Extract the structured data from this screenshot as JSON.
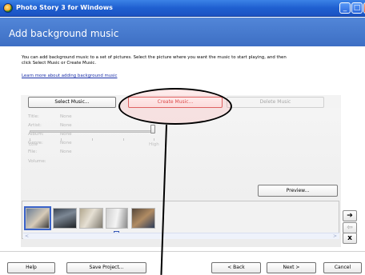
{
  "window": {
    "title": "Photo Story 3 for Windows",
    "icon": "photo-story-icon",
    "controls": {
      "minimize": "_",
      "maximize": "□",
      "close": "x"
    }
  },
  "header": {
    "title": "Add background music"
  },
  "instructions": {
    "line1": "You can add background music to a set of pictures.  Select the picture where you want the music to start playing, and then",
    "line2": "click Select Music or Create Music.",
    "learn_more": "Learn more about adding background music"
  },
  "music_buttons": {
    "select": "Select Music...",
    "create": "Create Music...",
    "delete": "Delete Music"
  },
  "metadata": [
    {
      "key": "Title:",
      "value": "None"
    },
    {
      "key": "Artist:",
      "value": "None"
    },
    {
      "key": "Album:",
      "value": "None"
    },
    {
      "key": "Genre:",
      "value": "None"
    },
    {
      "key": "File:",
      "value": "None"
    }
  ],
  "volume": {
    "label": "Volume:",
    "low": "Low",
    "high": "High",
    "level": 1.0
  },
  "preview_button": "Preview...",
  "filmstrip": {
    "thumbnails": [
      "photo-1",
      "photo-2",
      "photo-3",
      "photo-4",
      "photo-5"
    ]
  },
  "side_buttons": {
    "right": "➔",
    "left": "⇦",
    "remove": "x"
  },
  "bottom_buttons": {
    "help": "Help",
    "save": "Save Project...",
    "back": "< Back",
    "next": "Next >",
    "cancel": "Cancel"
  },
  "colors": {
    "title_bar": "#1f5fd0",
    "header": "#4a7bd0",
    "link": "#1a2fa8",
    "highlight": "#d43a3a"
  }
}
